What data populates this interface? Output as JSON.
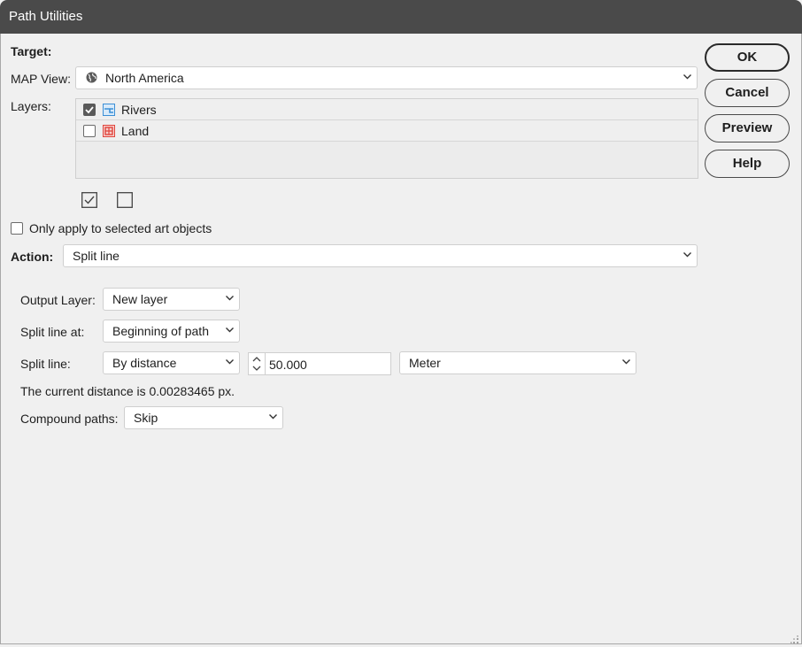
{
  "window": {
    "title": "Path Utilities"
  },
  "target": {
    "heading": "Target:",
    "map_view_label": "MAP View:",
    "map_view_value": "North America",
    "layers_label": "Layers:",
    "layers": [
      {
        "name": "Rivers",
        "checked": true,
        "icon": "line-layer-icon",
        "icon_color": "#3b8fd6"
      },
      {
        "name": "Land",
        "checked": false,
        "icon": "area-layer-icon",
        "icon_color": "#e0443c"
      }
    ],
    "select_all_icon": "checkbox-checked-icon",
    "select_none_icon": "checkbox-empty-icon"
  },
  "only_selected": {
    "label": "Only apply to selected art objects",
    "checked": false
  },
  "action": {
    "label": "Action:",
    "value": "Split line"
  },
  "options": {
    "output_layer_label": "Output Layer:",
    "output_layer_value": "New layer",
    "split_at_label": "Split line at:",
    "split_at_value": "Beginning of path",
    "split_line_label": "Split line:",
    "split_line_mode": "By distance",
    "split_line_distance": "50.000",
    "split_line_unit": "Meter",
    "current_distance_text": "The current distance is 0.00283465 px.",
    "compound_label": "Compound paths:",
    "compound_value": "Skip"
  },
  "buttons": {
    "ok": "OK",
    "cancel": "Cancel",
    "preview": "Preview",
    "help": "Help"
  }
}
